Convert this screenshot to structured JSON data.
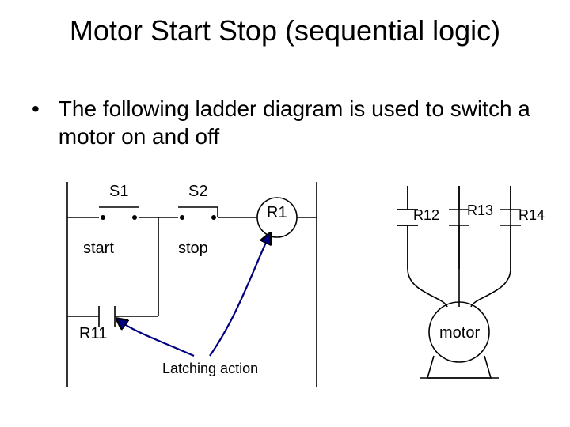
{
  "title": "Motor Start Stop (sequential logic)",
  "bullet": "The following ladder diagram is used to switch a motor on and off",
  "labels": {
    "s1": "S1",
    "s2": "S2",
    "start": "start",
    "stop": "stop",
    "r1": "R1",
    "r11": "R11",
    "r12": "R12",
    "r13": "R13",
    "r14": "R14",
    "motor": "motor",
    "latching": "Latching action"
  }
}
